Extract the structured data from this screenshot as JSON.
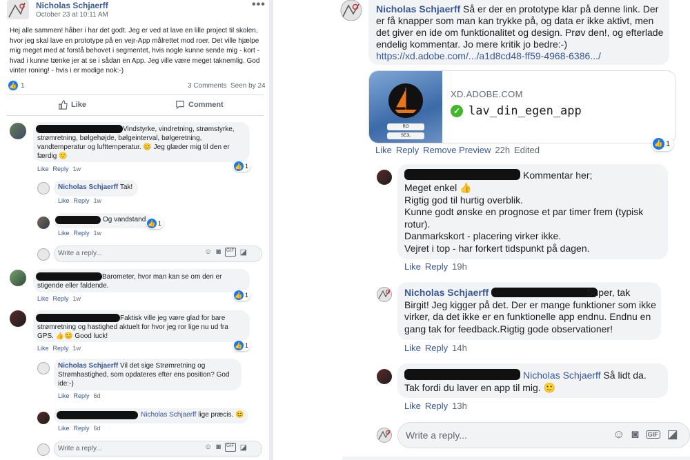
{
  "left": {
    "post": {
      "author": "Nicholas Schjaerff",
      "date": "October 23 at 10:11 AM",
      "more_icon": "more-dots-icon",
      "text": "Hej alle sammen! håber i har det godt. Jeg er ved at lave en lille project til skolen, hvor jeg skal lave en prototype på en vejr-App målrettet mod roer. Det ville hjælpe mig meget med at forstå behovet i segmentet, hvis nogle kunne sende mig - kort - hvad i kunne tænke jer at se i sådan en App. Jeg ville være meget taknemlig. God vinter roning! - hvis i er modige nok:-)",
      "reactions_count": "1",
      "comments_count": "3 Comments",
      "seen_by": "Seen by 24",
      "like_label": "Like",
      "comment_label": "Comment"
    },
    "comments": [
      {
        "text": "Vindstyrke, vindretning, strømstyrke, strømretning, bølgehøjde, bølgeinterval, bølgeretning, vandtemperatur og lufttemperatur. 😊 Jeg glæder mig til den er færdig 🙂",
        "actions": [
          "Like",
          "Reply",
          "1w"
        ],
        "react": "1"
      },
      {
        "author": "Nicholas Schjaerff",
        "text": "Tak!",
        "actions": [
          "Like",
          "Reply",
          "1w"
        ]
      },
      {
        "text": "Og vandstand",
        "actions": [
          "Like",
          "Reply",
          "1w"
        ],
        "react": "1"
      },
      {
        "text": "Barometer, hvor man kan se om den er stigende eller faldende.",
        "actions": [
          "Like",
          "Reply",
          "1w"
        ],
        "react": "1"
      },
      {
        "text": "Faktisk ville jeg være glad for bare strømretning og hastighed aktuelt for hvor jeg ror lige nu ud fra GPS. 👍😊 Good luck!",
        "actions": [
          "Like",
          "Reply",
          "1w"
        ],
        "react": "1"
      },
      {
        "author": "Nicholas Schjaerff",
        "text": "Vil det sige Strømretning og Strømhastighed, som opdateres efter ens position? God ide:-)",
        "actions": [
          "Like",
          "Reply",
          "6d"
        ]
      },
      {
        "mention": "Nicholas Schjaerff",
        "text": "lige præcis. 😊",
        "actions": [
          "Like",
          "Reply",
          "6d"
        ]
      }
    ],
    "write_placeholder": "Write a reply..."
  },
  "right": {
    "main_comment": {
      "author": "Nicholas Schjaerff",
      "text": "Så er der en prototype klar på denne link. Der er få knapper som man kan trykke på, og data er ikke aktivt, men det giver en ide om funktionalitet og design. Prøv den!, og efterlade endelig kommentar. Jo mere kritik jo bedre:-)",
      "link": "https://xd.adobe.com/.../a1d8cd48-ff59-4968-6386.../",
      "preview_domain": "XD.ADOBE.COM",
      "preview_title": "lav_din_egen_app",
      "thumb_btn1": "RO",
      "thumb_btn2": "SEJL",
      "actions": [
        "Like",
        "Reply",
        "Remove Preview",
        "22h",
        "Edited"
      ],
      "react": "1"
    },
    "replies": [
      {
        "text_head": "Kommentar her;",
        "lines": [
          "Meget enkel 👍",
          "Rigtig god til hurtig overblik.",
          "Kunne godt ønske en prognose et par timer frem (typisk",
          "rotur).",
          "Danmarkskort - placering virker ikke.",
          "Vejret i top - har forkert tidspunkt på dagen."
        ],
        "actions": [
          "Like",
          "Reply",
          "19h"
        ]
      },
      {
        "author": "Nicholas Schjaerff",
        "text": "Super, tak Birgit! Jeg kigger på det. Der er mange funktioner som ikke virker, da det ikke er en funktionelle app endnu. Endnu en gang tak for feedback.Rigtig gode observationer!",
        "actions": [
          "Like",
          "Reply",
          "14h"
        ]
      },
      {
        "mention": "Nicholas Schjaerff",
        "text": "Så lidt da. Tak fordi du laver en app til mig. 🙂",
        "actions": [
          "Like",
          "Reply",
          "13h"
        ]
      }
    ],
    "write_placeholder": "Write a reply..."
  },
  "icons": [
    "like-thumb-icon",
    "comment-bubble-icon",
    "emoji-icon",
    "camera-icon",
    "gif-icon",
    "sticker-icon",
    "check-icon"
  ],
  "colors": {
    "link": "#385898",
    "accent": "#1877f2",
    "bubble": "#f2f3f5",
    "muted": "#606770"
  }
}
